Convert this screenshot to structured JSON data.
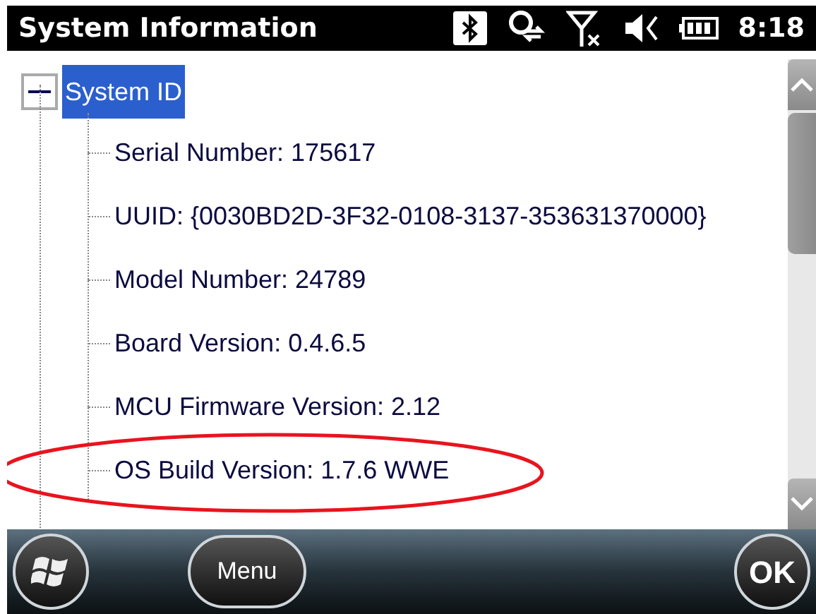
{
  "status_bar": {
    "title": "System Information",
    "time": "8:18"
  },
  "tree": {
    "label": "System ID",
    "expanded": true,
    "selected": true,
    "children": [
      {
        "label": "Serial Number: 175617",
        "selected": false
      },
      {
        "label": "UUID: {0030BD2D-3F32-0108-3137-353631370000}",
        "selected": false
      },
      {
        "label": "Model Number: 24789",
        "selected": false
      },
      {
        "label": "Board Version: 0.4.6.5",
        "selected": false
      },
      {
        "label": "MCU Firmware Version: 2.12",
        "selected": false
      },
      {
        "label": "OS Build Version: 1.7.6 WWE",
        "selected": false,
        "circled": true
      }
    ]
  },
  "softkeys": {
    "menu": "Menu",
    "ok": "OK"
  }
}
